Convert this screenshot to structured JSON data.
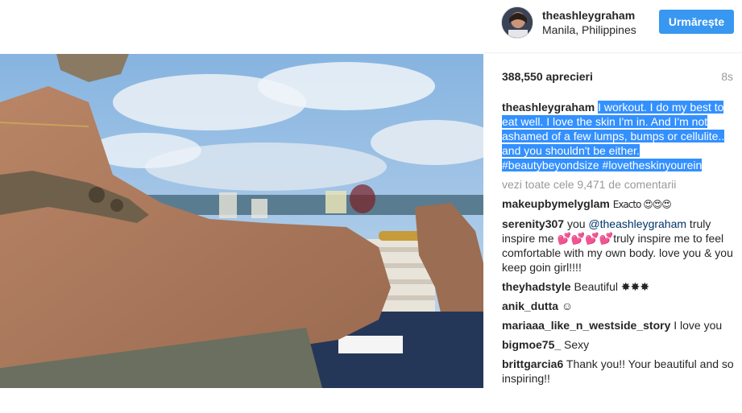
{
  "header": {
    "username": "theashleygraham",
    "location": "Manila, Philippines",
    "follow_label": "Urmărește"
  },
  "post": {
    "likes": "388,550 aprecieri",
    "time_ago": "8s"
  },
  "caption": {
    "username": "theashleygraham",
    "text": "I workout. I do my best to eat well. I love the skin I'm in. And I'm not ashamed of a few lumps, bumps or cellulite.. and you shouldn't be either.",
    "hashtags": "#beautybeyondsize #lovetheskinyourein"
  },
  "view_all_comments": "vezi toate cele 9,471 de comentarii",
  "comments": [
    {
      "username": "makeupbymelyglam",
      "text": "Exacto 😍😍😍"
    },
    {
      "username": "serenity307",
      "pre": "you ",
      "mention": "@theashleygraham",
      "text": " truly inspire me 💕💕💕💕truly inspire me to feel comfortable with my own body. love you & you keep goin girl!!!!"
    },
    {
      "username": "theyhadstyle",
      "text": "Beautiful ✸✸✸"
    },
    {
      "username": "anik_dutta",
      "text": "☺"
    },
    {
      "username": "mariaaa_like_n_westside_story",
      "text": "I love you"
    },
    {
      "username": "bigmoe75_",
      "text": "Sexy"
    },
    {
      "username": "brittgarcia6",
      "text": "Thank you!! Your beautiful and so inspiring!!"
    }
  ],
  "colors": {
    "follow_button": "#3897f0",
    "selection": "#3390ff",
    "link": "#003569"
  }
}
